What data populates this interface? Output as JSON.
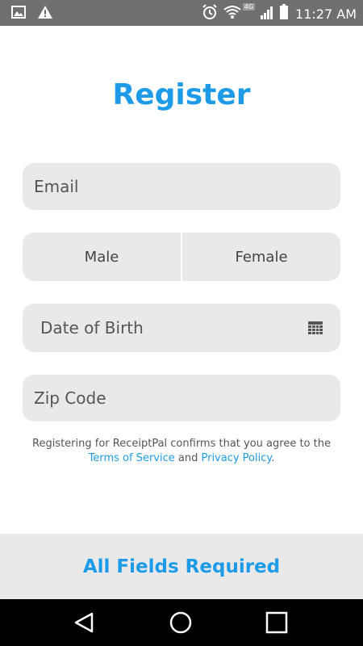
{
  "status_bar": {
    "time": "11:27 AM",
    "network_badge": "4G",
    "icons": [
      "image-icon",
      "warning-icon",
      "alarm-icon",
      "wifi-icon",
      "signal-icon",
      "battery-icon"
    ]
  },
  "header": {
    "title": "Register"
  },
  "form": {
    "email_placeholder": "Email",
    "gender_options": [
      "Male",
      "Female"
    ],
    "dob_placeholder": "Date of Birth",
    "zip_placeholder": "Zip Code"
  },
  "terms": {
    "text_line1": "Registering for ReceiptPal confirms that you agree to the",
    "terms_link": "Terms of Service",
    "and_text": " and ",
    "privacy_link": "Privacy Policy",
    "end_text": "."
  },
  "footer": {
    "label": "All Fields Required"
  },
  "colors": {
    "accent": "#1e9be8",
    "field_bg": "#e9e9e9",
    "status_bar_bg": "#6f6f6f"
  },
  "nav": {
    "icons": [
      "back-icon",
      "home-icon",
      "recents-icon"
    ]
  }
}
